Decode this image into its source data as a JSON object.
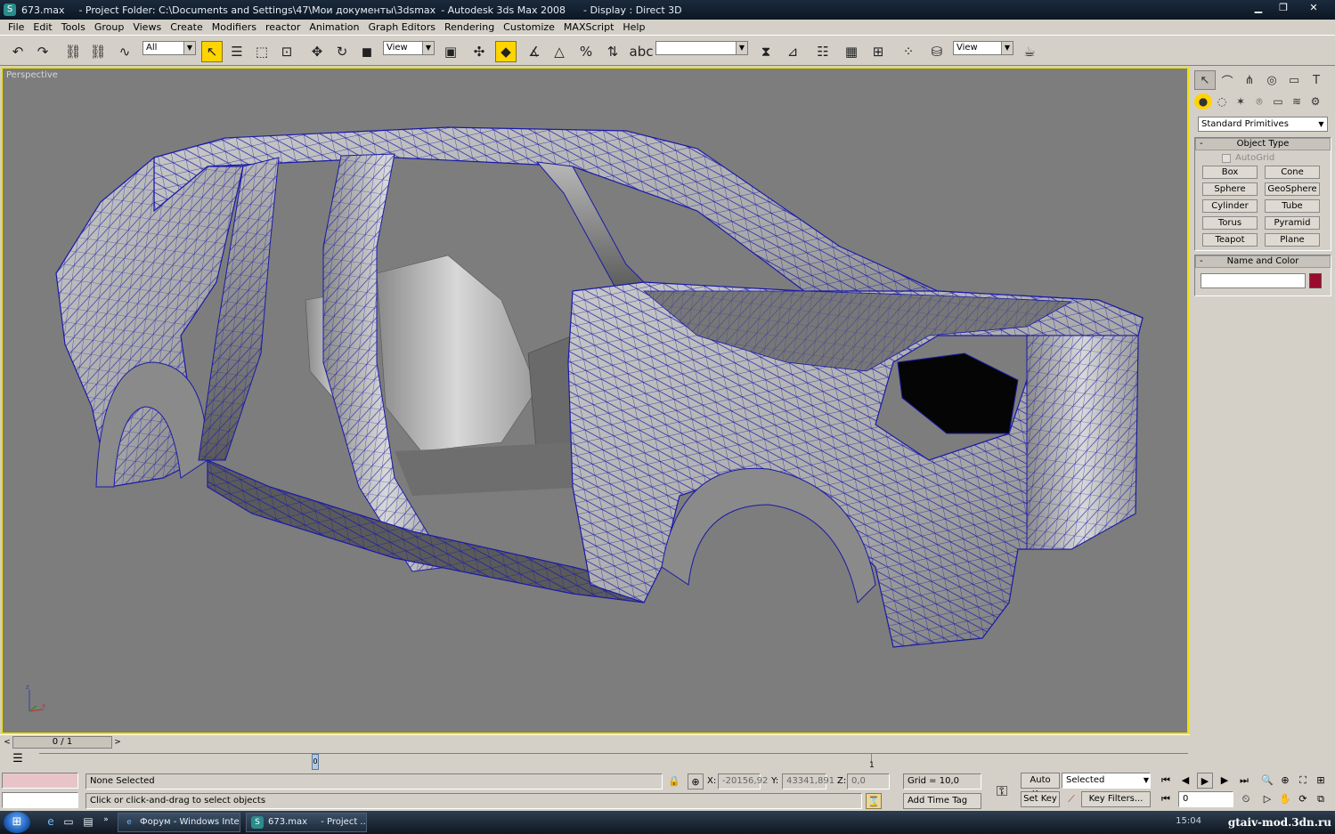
{
  "window": {
    "file": "673.max",
    "project": "- Project Folder: C:\\Documents and Settings\\47\\Мои документы\\3dsmax",
    "app": "- Autodesk 3ds Max 2008",
    "display": "- Display : Direct 3D"
  },
  "menu": [
    "File",
    "Edit",
    "Tools",
    "Group",
    "Views",
    "Create",
    "Modifiers",
    "reactor",
    "Animation",
    "Graph Editors",
    "Rendering",
    "Customize",
    "MAXScript",
    "Help"
  ],
  "toolbar": {
    "selection_filter": "All",
    "ref_coord": "View",
    "named_selection": "",
    "render_view": "View"
  },
  "viewport": {
    "label": "Perspective",
    "wire_color": "#1a1aa8"
  },
  "command_panel": {
    "category": "Standard Primitives",
    "object_type_title": "Object Type",
    "autogrid": "AutoGrid",
    "buttons": [
      "Box",
      "Cone",
      "Sphere",
      "GeoSphere",
      "Cylinder",
      "Tube",
      "Torus",
      "Pyramid",
      "Teapot",
      "Plane"
    ],
    "name_color_title": "Name and Color",
    "object_color": "#9a0b2c"
  },
  "time": {
    "slider_label": "0 / 1",
    "track_marker": "0",
    "end_tick": "1"
  },
  "status": {
    "selection": "None Selected",
    "prompt": "Click or click-and-drag to select objects",
    "x_label": "X:",
    "x": "-20156,92",
    "y_label": "Y:",
    "y": "43341,891",
    "z_label": "Z:",
    "z": "0,0",
    "grid": "Grid = 10,0",
    "add_time_tag": "Add Time Tag",
    "auto_key": "Auto Key",
    "key_mode": "Selected",
    "set_key": "Set Key",
    "key_filters": "Key Filters...",
    "frame": "0"
  },
  "taskbar": {
    "task1": "Форум - Windows Inte...",
    "task2_file": "673.max",
    "task2_project": "- Project ...",
    "clock": "15:04"
  },
  "watermark": "gtaiv-mod.3dn.ru"
}
